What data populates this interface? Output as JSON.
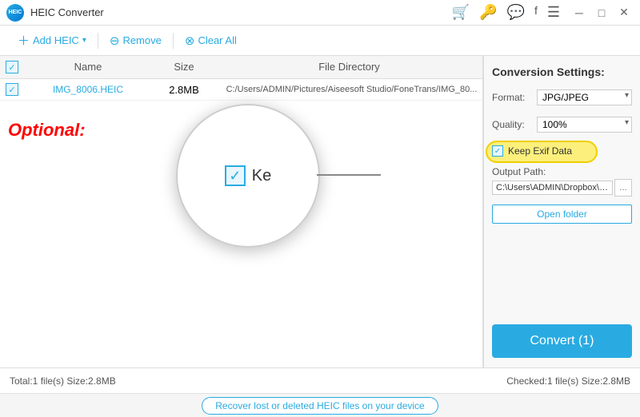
{
  "titleBar": {
    "appName": "HEIC Converter",
    "logo": "HEIC"
  },
  "toolbar": {
    "addLabel": "Add HEIC",
    "removeLabel": "Remove",
    "clearLabel": "Clear All"
  },
  "table": {
    "headers": {
      "name": "Name",
      "size": "Size",
      "directory": "File Directory"
    },
    "rows": [
      {
        "checked": true,
        "name": "IMG_8006.HEIC",
        "size": "2.8MB",
        "directory": "C:/Users/ADMIN/Pictures/Aiseesoft Studio/FoneTrans/IMG_80..."
      }
    ]
  },
  "optional": "Optional:",
  "zoomContent": {
    "label": "Ke"
  },
  "rightPanel": {
    "title": "Conversion Settings:",
    "formatLabel": "Format:",
    "formatValue": "JPG/JPEG",
    "qualityLabel": "Quality:",
    "qualityValue": "100%",
    "keepExifLabel": "Keep Exif Data",
    "outputPathLabel": "Output Path:",
    "outputPathValue": "C:\\Users\\ADMIN\\Dropbox\\PC",
    "openFolderLabel": "Open folder",
    "convertLabel": "Convert (1)"
  },
  "statusBar": {
    "totalText": "Total:1 file(s) Size:2.8MB",
    "checkedText": "Checked:1 file(s) Size:2.8MB"
  },
  "recoveryBar": {
    "linkText": "Recover lost or deleted HEIC files on your device"
  }
}
